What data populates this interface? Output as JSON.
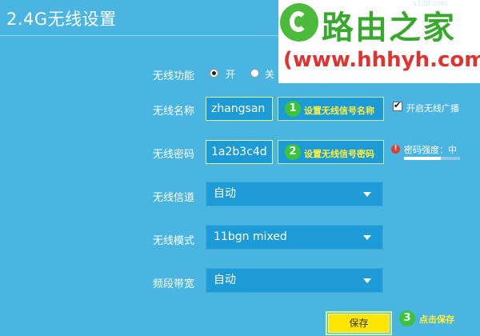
{
  "header": {
    "title": "2.4G无线设置"
  },
  "watermark": {
    "site_name": "路由之家",
    "url": "(www.hhhyh.com)",
    "subtext": "s338.com"
  },
  "wireless_function": {
    "label": "无线功能",
    "on_label": "开",
    "off_label": "关",
    "selected": "开"
  },
  "ssid": {
    "label": "无线名称",
    "value": "zhangsan",
    "step": "1",
    "hint": "设置无线信号名称",
    "broadcast_label": "开启无线广播",
    "broadcast_checked": true
  },
  "password": {
    "label": "无线密码",
    "value": "1a2b3c4d",
    "step": "2",
    "hint": "设置无线信号密码",
    "warning_icon": "!",
    "strength_label": "密码强度：中",
    "strength_fraction": 0.65
  },
  "channel": {
    "label": "无线信道",
    "value": "自动"
  },
  "mode": {
    "label": "无线模式",
    "value": "11bgn mixed"
  },
  "bandwidth": {
    "label": "频段带宽",
    "value": "自动"
  },
  "save": {
    "label": "保存",
    "step": "3",
    "hint": "点击保存"
  },
  "colors": {
    "background": "#49b5e0",
    "field": "#1d9bd6",
    "hint_text": "#ffef3a",
    "save_button": "#ffe600",
    "badge": "#3cc43c"
  }
}
